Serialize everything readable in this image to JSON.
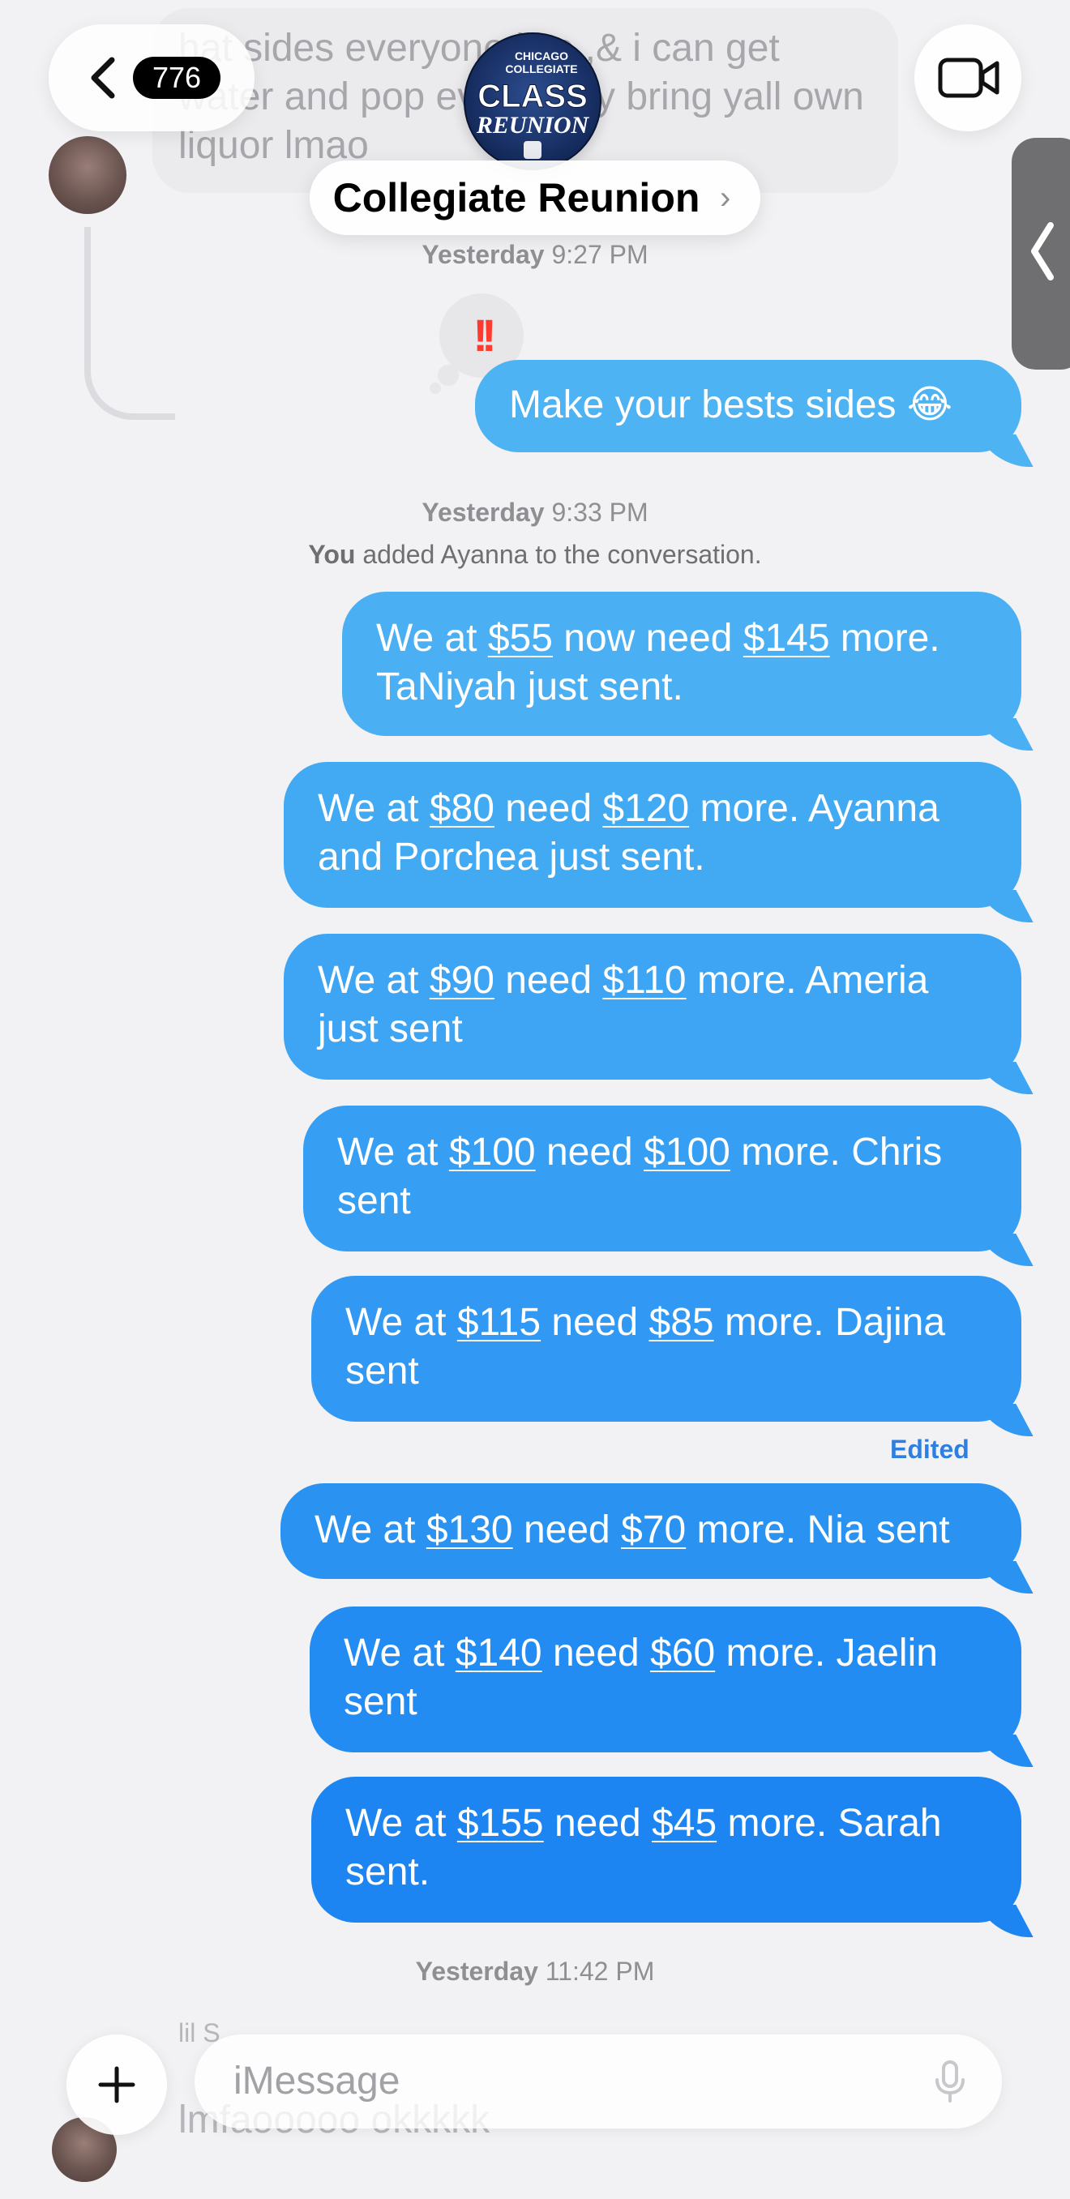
{
  "header": {
    "unread_count": "776",
    "group_name": "Collegiate Reunion",
    "logo_text": {
      "line1": "CHICAGO",
      "line2": "COLLEGIATE",
      "line3": "CLASS",
      "line4": "REUNION"
    }
  },
  "top_message": {
    "text": "hat sides everyone like ,& i can get water and pop everybody bring yall own liquor lmao"
  },
  "timestamps": [
    {
      "day": "Yesterday",
      "time": "9:27 PM"
    },
    {
      "day": "Yesterday",
      "time": "9:33 PM"
    },
    {
      "day": "Yesterday",
      "time": "11:42 PM"
    }
  ],
  "reaction": {
    "symbol": "!!"
  },
  "system_message": {
    "actor": "You",
    "text": "added Ayanna  to the conversation."
  },
  "messages": [
    {
      "pre": "Make your bests sides 😂",
      "a1": "",
      "mid": "",
      "a2": "",
      "post": ""
    },
    {
      "pre": "We at ",
      "a1": "$55",
      "mid": " now need ",
      "a2": "$145",
      "post": " more. TaNiyah just sent."
    },
    {
      "pre": "We at ",
      "a1": "$80",
      "mid": " need ",
      "a2": "$120",
      "post": " more. Ayanna and Porchea just sent."
    },
    {
      "pre": "We at ",
      "a1": "$90",
      "mid": " need ",
      "a2": "$110",
      "post": " more. Ameria just sent"
    },
    {
      "pre": "We at ",
      "a1": "$100",
      "mid": " need ",
      "a2": "$100",
      "post": " more. Chris sent"
    },
    {
      "pre": "We at ",
      "a1": "$115",
      "mid": " need ",
      "a2": "$85",
      "post": " more. Dajina sent"
    },
    {
      "pre": "We at ",
      "a1": "$130",
      "mid": " need ",
      "a2": "$70",
      "post": " more. Nia sent"
    },
    {
      "pre": "We at ",
      "a1": "$140",
      "mid": " need ",
      "a2": "$60",
      "post": " more. Jaelin sent"
    },
    {
      "pre": "We at ",
      "a1": "$155",
      "mid": " need ",
      "a2": "$45",
      "post": " more. Sarah sent."
    }
  ],
  "edited_label": "Edited",
  "composer": {
    "placeholder": "iMessage",
    "sender_preview": "lil S",
    "message_preview": "lmfaooooo okkkkk"
  },
  "colors": {
    "outgoing_light": "#49aef0",
    "outgoing_dark": "#1b82f2",
    "background": "#f2f2f4"
  },
  "icons": [
    "back-chevron-icon",
    "video-camera-icon",
    "plus-icon",
    "microphone-icon",
    "side-chevron-icon"
  ]
}
